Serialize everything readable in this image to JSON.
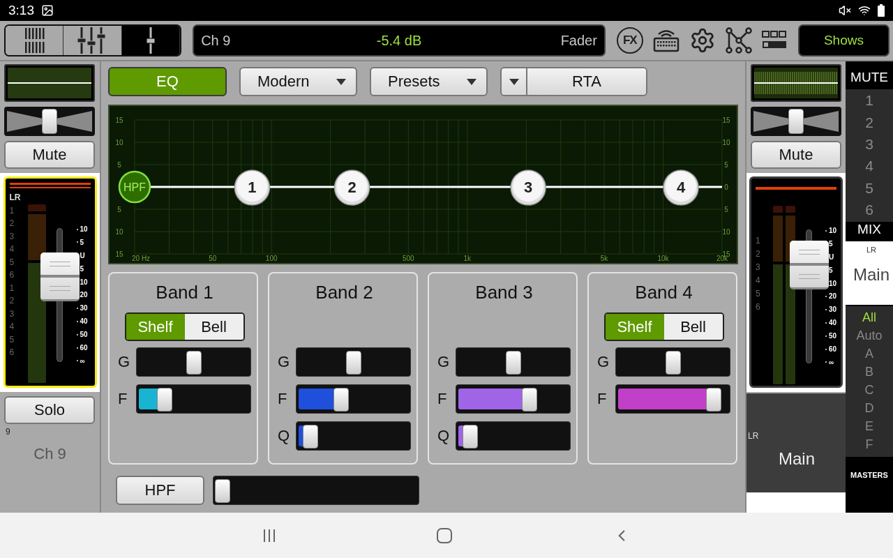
{
  "status_bar": {
    "time": "3:13"
  },
  "toolbar": {
    "views": [
      {
        "kind": "mixer",
        "selected": false
      },
      {
        "kind": "faders",
        "selected": false
      },
      {
        "kind": "single",
        "selected": true
      }
    ],
    "channel_display": {
      "channel": "Ch 9",
      "value": "-5.4 dB",
      "mode": "Fader"
    },
    "fx_label": "FX",
    "shows_button": "Shows"
  },
  "left_strip": {
    "pan": {
      "level": 0.5
    },
    "mute_button": "Mute",
    "fader": {
      "kind": "mono",
      "selected": true,
      "level": 0.64,
      "assign_labels": [
        "LR",
        "1",
        "2",
        "3",
        "4",
        "5",
        "6",
        "1",
        "2",
        "3",
        "4",
        "5",
        "6"
      ],
      "scale": [
        "10",
        "5",
        "U",
        "5",
        "10",
        "20",
        "30",
        "40",
        "50",
        "60",
        "∞"
      ]
    },
    "solo_button": "Solo",
    "channel_number": "9",
    "channel_name": "Ch 9"
  },
  "eq": {
    "eq_button": {
      "label": "EQ",
      "on": true
    },
    "mode_dropdown": "Modern",
    "presets_dropdown": "Presets",
    "rta_button": "RTA",
    "graph": {
      "left_axis_labels": [
        "15",
        "10",
        "5",
        "5",
        "10",
        "15"
      ],
      "right_axis_labels": [
        "15",
        "10",
        "5",
        "0",
        "5",
        "10",
        "15"
      ],
      "frequency_labels": [
        "20 Hz",
        "50",
        "100",
        "500",
        "1k",
        "5k",
        "10k",
        "20k"
      ]
    },
    "bands": [
      {
        "title": "Band 1",
        "node": "1",
        "shape": [
          {
            "label": "Shelf",
            "selected": true
          },
          {
            "label": "Bell",
            "selected": false
          }
        ],
        "sliders": [
          {
            "kind": "gain",
            "label": "G",
            "level": 0.5
          },
          {
            "kind": "freq",
            "label": "F",
            "level": 0.2,
            "color": "#18b4d2"
          }
        ]
      },
      {
        "title": "Band 2",
        "node": "2",
        "sliders": [
          {
            "kind": "gain",
            "label": "G",
            "level": 0.5
          },
          {
            "kind": "freq",
            "label": "F",
            "level": 0.37,
            "color": "#1e50dc"
          },
          {
            "kind": "q",
            "label": "Q",
            "level": 0.05,
            "color": "#1e50dc"
          }
        ]
      },
      {
        "title": "Band 3",
        "node": "3",
        "sliders": [
          {
            "kind": "gain",
            "label": "G",
            "level": 0.5
          },
          {
            "kind": "freq",
            "label": "F",
            "level": 0.67,
            "color": "#a064e6"
          },
          {
            "kind": "q",
            "label": "Q",
            "level": 0.05,
            "color": "#a064e6"
          }
        ]
      },
      {
        "title": "Band 4",
        "node": "4",
        "shape": [
          {
            "label": "Shelf",
            "selected": true
          },
          {
            "label": "Bell",
            "selected": false
          }
        ],
        "sliders": [
          {
            "kind": "gain",
            "label": "G",
            "level": 0.5
          },
          {
            "kind": "freq",
            "label": "F",
            "level": 0.93,
            "color": "#c040c8"
          }
        ]
      }
    ],
    "hpf": {
      "label": "HPF",
      "node": "HPF",
      "level": 0.0
    }
  },
  "right_strip": {
    "pan": {
      "level": 0.5
    },
    "mute_button": "Mute",
    "fader": {
      "kind": "stereo",
      "selected": false,
      "level": 0.74,
      "assign_labels": [
        "1",
        "2",
        "3",
        "4",
        "5",
        "6"
      ],
      "scale": [
        "10",
        "5",
        "U",
        "5",
        "10",
        "20",
        "30",
        "40",
        "50",
        "60",
        "∞"
      ]
    },
    "bus_label": "LR",
    "bus_name": "Main"
  },
  "sidebar": {
    "mute_header": "MUTE",
    "mute_groups": [
      {
        "label": "1",
        "on": false
      },
      {
        "label": "2",
        "on": false
      },
      {
        "label": "3",
        "on": false
      },
      {
        "label": "4",
        "on": false
      },
      {
        "label": "5",
        "on": false
      },
      {
        "label": "6",
        "on": false
      }
    ],
    "mix_header": "MIX",
    "mix": {
      "tag": "LR",
      "name": "Main",
      "selected": true
    },
    "filters": [
      {
        "label": "All",
        "selected": true
      },
      {
        "label": "Auto",
        "selected": false
      },
      {
        "label": "A",
        "selected": false
      },
      {
        "label": "B",
        "selected": false
      },
      {
        "label": "C",
        "selected": false
      },
      {
        "label": "D",
        "selected": false
      },
      {
        "label": "E",
        "selected": false
      },
      {
        "label": "F",
        "selected": false
      }
    ],
    "masters": "MASTERS"
  }
}
